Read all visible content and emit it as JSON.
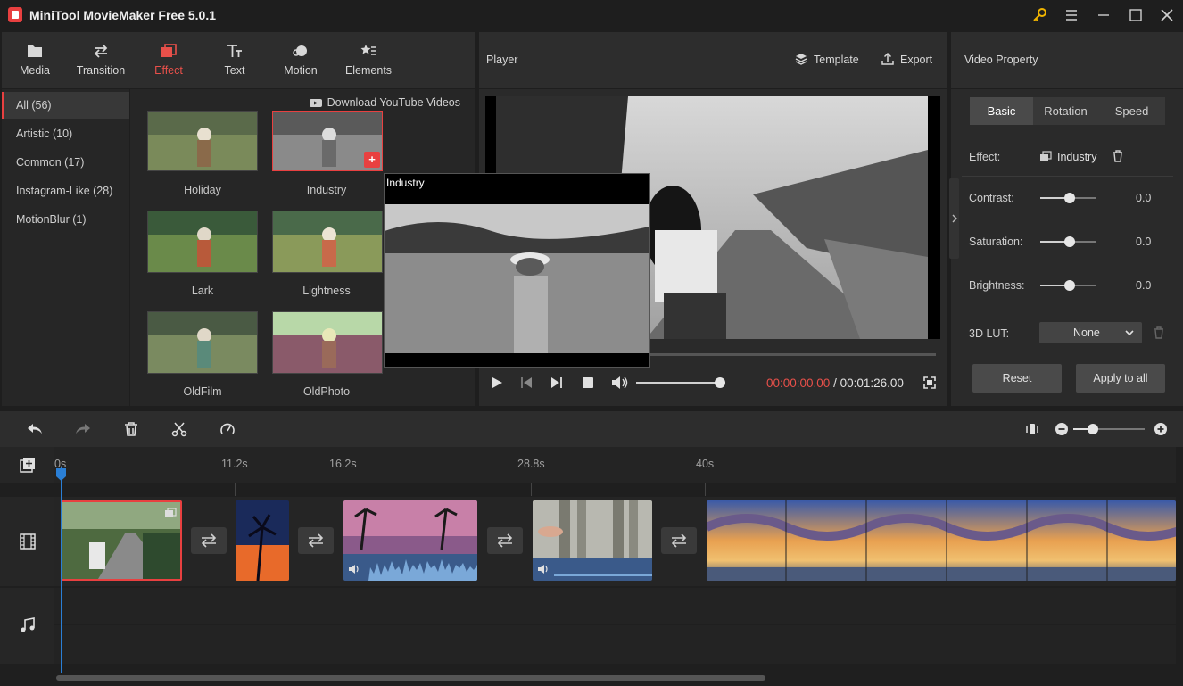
{
  "app": {
    "title": "MiniTool MovieMaker Free 5.0.1"
  },
  "library_tabs": [
    {
      "label": "Media",
      "icon": "folder-icon"
    },
    {
      "label": "Transition",
      "icon": "transition-arrows-icon"
    },
    {
      "label": "Effect",
      "icon": "effect-icon"
    },
    {
      "label": "Text",
      "icon": "text-icon"
    },
    {
      "label": "Motion",
      "icon": "motion-icon"
    },
    {
      "label": "Elements",
      "icon": "elements-icon"
    }
  ],
  "categories": [
    "All (56)",
    "Artistic (10)",
    "Common (17)",
    "Instagram-Like (28)",
    "MotionBlur (1)"
  ],
  "download_link": "Download YouTube Videos",
  "effects": [
    "Holiday",
    "Industry",
    "Lark",
    "Lightness",
    "OldFilm",
    "OldPhoto"
  ],
  "preview_popup": {
    "title": "Industry"
  },
  "player": {
    "title": "Player",
    "template_label": "Template",
    "export_label": "Export",
    "current_time": "00:00:00.00",
    "separator": " / ",
    "total_time": "00:01:26.00"
  },
  "property": {
    "title": "Video Property",
    "tabs": [
      "Basic",
      "Rotation",
      "Speed"
    ],
    "effect_label": "Effect:",
    "effect_value": "Industry",
    "contrast_label": "Contrast:",
    "contrast_value": "0.0",
    "saturation_label": "Saturation:",
    "saturation_value": "0.0",
    "brightness_label": "Brightness:",
    "brightness_value": "0.0",
    "lut_label": "3D LUT:",
    "lut_value": "None",
    "reset_label": "Reset",
    "apply_all_label": "Apply to all"
  },
  "timeline": {
    "ticks": [
      "0s",
      "11.2s",
      "16.2s",
      "28.8s",
      "40s"
    ]
  },
  "colors": {
    "accent": "#e84040",
    "time_current": "#e8504a",
    "playhead": "#2a7fd6"
  }
}
